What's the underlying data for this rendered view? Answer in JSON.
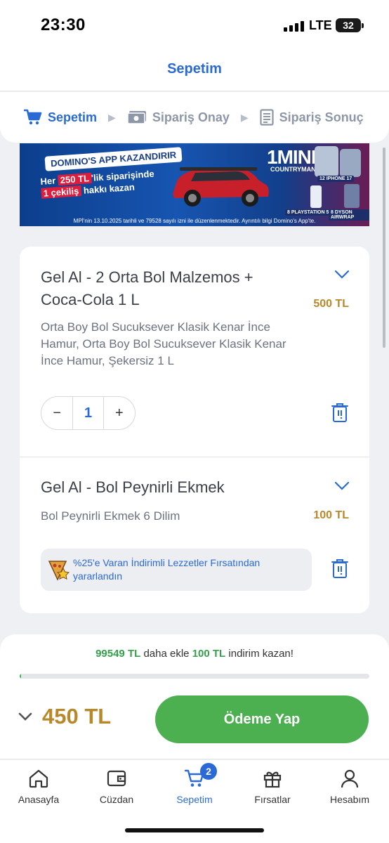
{
  "status_bar": {
    "time": "23:30",
    "network": "LTE",
    "battery": "32"
  },
  "header": {
    "title": "Sepetim"
  },
  "steps": [
    {
      "label": "Sepetim",
      "icon": "cart-icon",
      "active": true
    },
    {
      "label": "Sipariş Onay",
      "icon": "money-icon",
      "active": false
    },
    {
      "label": "Sipariş Sonuç",
      "icon": "receipt-icon",
      "active": false
    }
  ],
  "banner": {
    "badge": "DOMINO'S APP KAZANDIRIR",
    "line_pre": "Her",
    "line_amount": "250 TL",
    "line_mid": "'lik siparişinde",
    "line_draw": "1 çekiliş",
    "line_post": "hakkı kazan",
    "prize_main": "1MINI",
    "prize_main_sub": "COUNTRYMAN",
    "prize_phone": "12 IPHONE 17",
    "prize_ps": "8 PLAYSTATION 5",
    "prize_dyson": "8 DYSON AIRWRAP",
    "footnote": "MPİ'nin 13.10.2025 tarihli ve 79528 sayılı izni ile düzenlenmektedir. Ayrıntılı bilgi Domino's App'te."
  },
  "cart": {
    "items": [
      {
        "name": "Gel Al - 2 Orta Bol Malzemos + Coca-Cola 1 L",
        "price": "500 TL",
        "description": "Orta Boy Bol Sucuksever Klasik Kenar İnce Hamur, Orta Boy Bol Sucuksever Klasik Kenar İnce Hamur, Şekersiz 1 L",
        "quantity": "1",
        "minus": "−",
        "plus": "+"
      },
      {
        "name": "Gel Al - Bol Peynirli Ekmek",
        "price": "100 TL",
        "description": "Bol Peynirli Ekmek 6 Dilim",
        "promo": "%25'e Varan İndirimli Lezzetler Fırsatından yararlandın"
      }
    ]
  },
  "checkout": {
    "msg_amount": "99549 TL",
    "msg_mid": "daha ekle",
    "msg_discount": "100 TL",
    "msg_end": "indirim kazan!",
    "progress": 0.005,
    "total": "450 TL",
    "pay_label": "Ödeme Yap"
  },
  "tabbar": {
    "tabs": [
      {
        "label": "Anasayfa",
        "icon": "home-icon"
      },
      {
        "label": "Cüzdan",
        "icon": "wallet-icon"
      },
      {
        "label": "Sepetim",
        "icon": "cart-icon",
        "badge": "2",
        "active": true
      },
      {
        "label": "Fırsatlar",
        "icon": "gift-icon"
      },
      {
        "label": "Hesabım",
        "icon": "user-icon"
      }
    ]
  },
  "colors": {
    "accent": "#2a6ad6",
    "price": "#b9882a",
    "green": "#4caf50"
  }
}
